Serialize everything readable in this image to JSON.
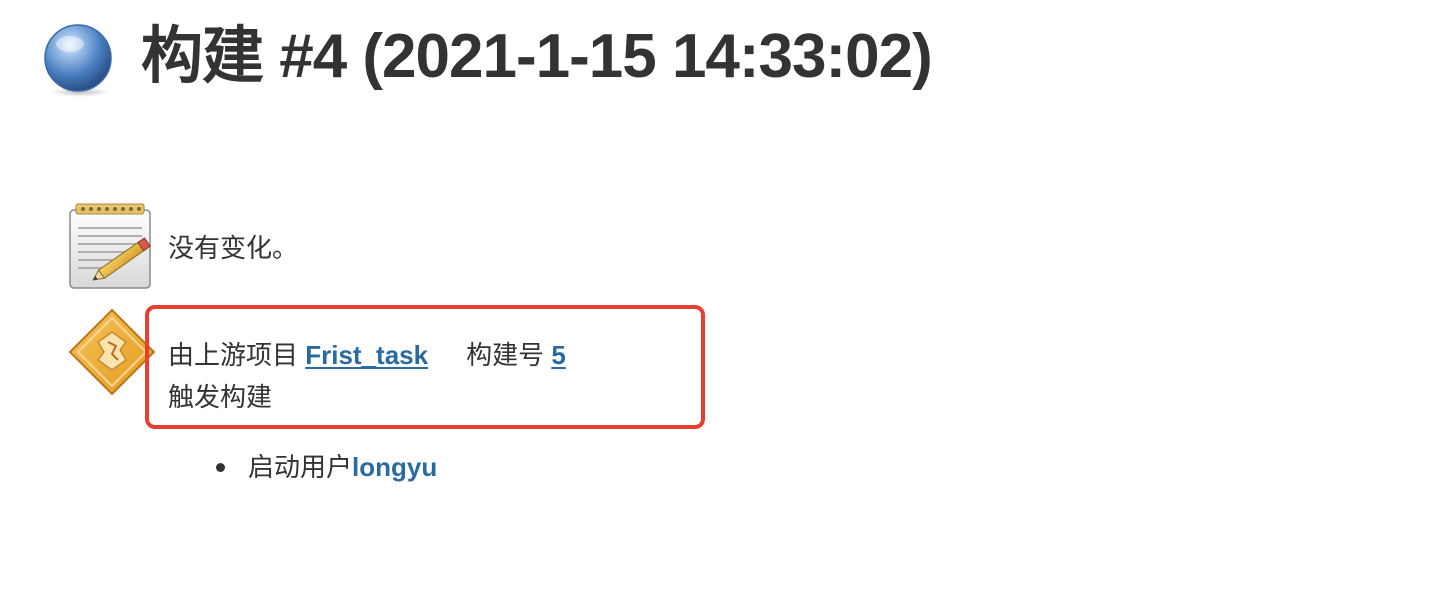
{
  "header": {
    "title": "构建 #4 (2021-1-15 14:33:02)",
    "status_icon": "blue-ball-icon",
    "status_color": "#4a7fc0"
  },
  "changes": {
    "icon": "notepad-icon",
    "text": "没有变化。"
  },
  "cause": {
    "icon": "upstream-project-icon",
    "prefix": "由上游项目",
    "project_link": "Frist_task",
    "build_label": "构建号",
    "build_number_link": "5",
    "suffix": "触发构建",
    "highlight_color": "#e8402f"
  },
  "started_by": {
    "label": "启动用户",
    "user_link": "longyu"
  },
  "colors": {
    "link": "#2b6aa0",
    "text": "#333333",
    "background": "#ffffff"
  }
}
